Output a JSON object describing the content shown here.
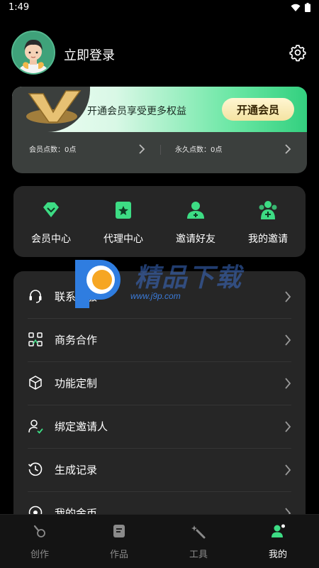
{
  "status": {
    "time": "1:49"
  },
  "profile": {
    "login_label": "立即登录"
  },
  "vip": {
    "promo_text": "开通会员享受更多权益",
    "cta_label": "开通会员",
    "member_points_label": "会员点数：0点",
    "permanent_points_label": "永久点数：0点"
  },
  "quick_actions": [
    {
      "label": "会员中心",
      "icon": "heart-diamond-icon"
    },
    {
      "label": "代理中心",
      "icon": "star-badge-icon"
    },
    {
      "label": "邀请好友",
      "icon": "add-person-icon"
    },
    {
      "label": "我的邀请",
      "icon": "group-add-icon"
    }
  ],
  "menu": [
    {
      "label": "联系客服",
      "icon": "headset-icon"
    },
    {
      "label": "商务合作",
      "icon": "business-icon"
    },
    {
      "label": "功能定制",
      "icon": "cube-icon"
    },
    {
      "label": "绑定邀请人",
      "icon": "bind-user-icon"
    },
    {
      "label": "生成记录",
      "icon": "history-icon"
    },
    {
      "label": "我的金币",
      "icon": "coin-icon"
    }
  ],
  "watermark": {
    "title": "精品下载",
    "url": "www.j9p.com"
  },
  "tabbar": [
    {
      "label": "创作",
      "icon": "create-icon",
      "active": false
    },
    {
      "label": "作品",
      "icon": "works-icon",
      "active": false
    },
    {
      "label": "工具",
      "icon": "tools-icon",
      "active": false
    },
    {
      "label": "我的",
      "icon": "profile-icon",
      "active": true
    }
  ],
  "colors": {
    "accent": "#3ddc84",
    "card_bg": "#262626",
    "background": "#000000"
  }
}
